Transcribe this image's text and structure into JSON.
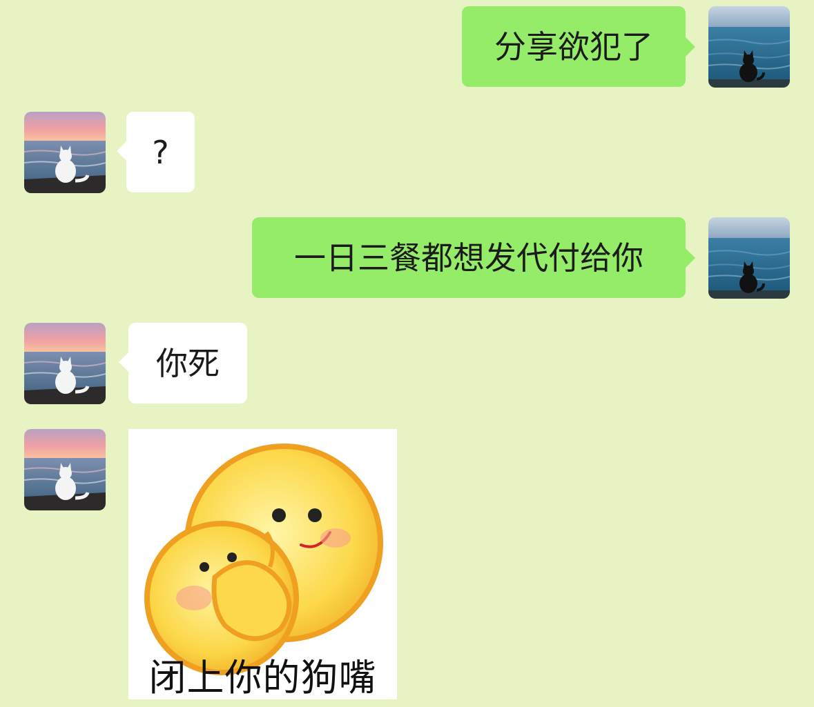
{
  "messages": [
    {
      "id": "m1",
      "side": "out",
      "type": "text",
      "text": "分享欲犯了"
    },
    {
      "id": "m2",
      "side": "in",
      "type": "text",
      "text": "?"
    },
    {
      "id": "m3",
      "side": "out",
      "type": "text",
      "text": "一日三餐都想发代付给你"
    },
    {
      "id": "m4",
      "side": "in",
      "type": "text",
      "text": "你死"
    },
    {
      "id": "m5",
      "side": "in",
      "type": "sticker",
      "caption": "闭上你的狗嘴"
    }
  ],
  "avatars": {
    "me": {
      "icon": "black-cat-by-ocean-avatar",
      "colors": {
        "sky": "#8fa9c2",
        "sea": "#2f6f95",
        "cat": "#1a1a1a"
      }
    },
    "them": {
      "icon": "white-cat-at-sunset-avatar",
      "colors": {
        "sky": "#e9a1a6",
        "sea": "#5f84a4",
        "cat": "#f4f4f4"
      }
    }
  },
  "colors": {
    "background": "#e8f3c4",
    "outgoing_bubble": "#95ec69",
    "incoming_bubble": "#ffffff"
  }
}
